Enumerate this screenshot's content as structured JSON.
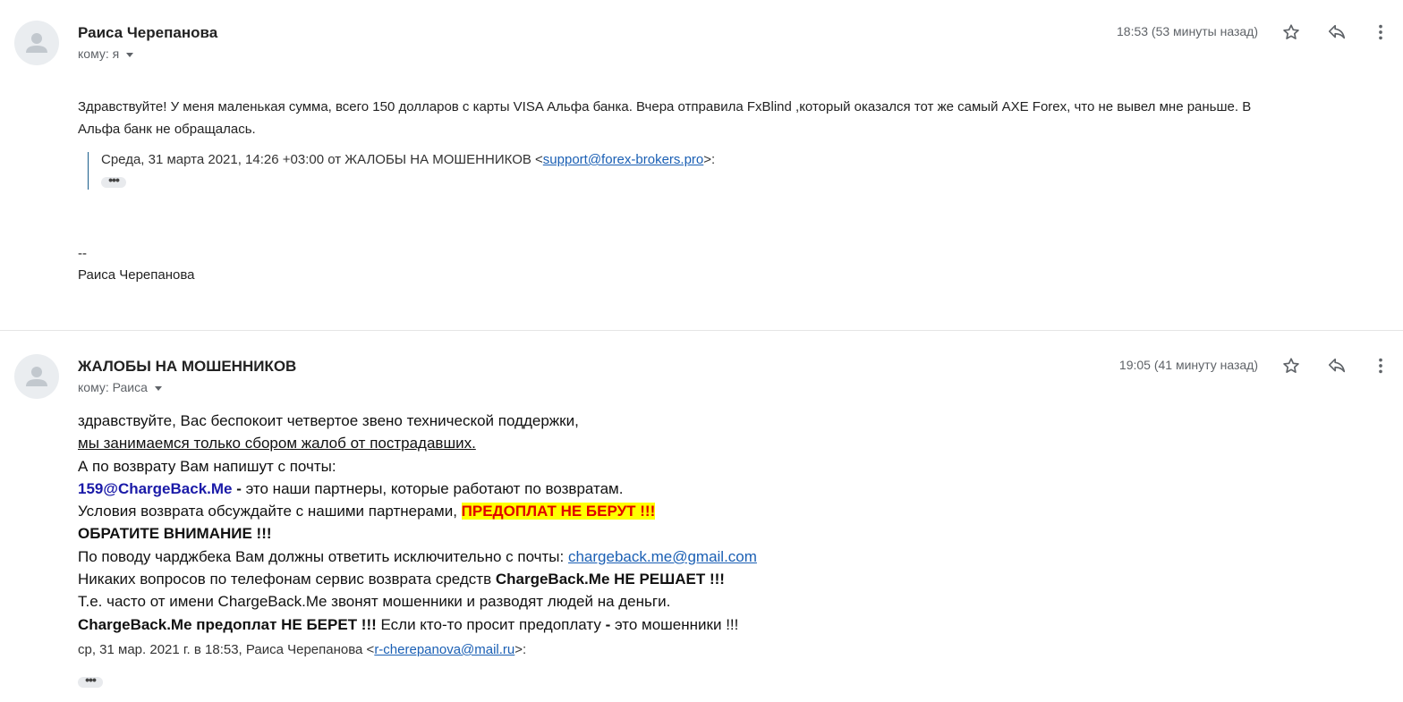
{
  "messages": [
    {
      "sender": "Раиса Черепанова",
      "to": "кому: я",
      "time": "18:53 (53 минуты назад)",
      "body_line1": "Здравствуйте! У меня маленькая сумма, всего 150 долларов с карты VISA Альфа банка. Вчера отправила FxBlind ,который оказался тот же самый AXE Forex, что не вывел мне раньше. В",
      "body_line2": "Альфа банк не обращалась.",
      "quote_prefix": "Среда, 31 марта 2021, 14:26 +03:00 от ЖАЛОБЫ НА МОШЕННИКОВ <",
      "quote_email": "support@forex-brokers.pro",
      "quote_suffix": ">:",
      "ellipsis": "•••",
      "sig_dash": "--",
      "sig_name": "Раиса Черепанова"
    },
    {
      "sender": "ЖАЛОБЫ НА МОШЕННИКОВ",
      "to": "кому: Раиса",
      "time": "19:05 (41 минуту назад)",
      "l1": "здравствуйте, Вас беспокоит четвертое звено технической поддержки,",
      "l2": "мы занимаемся только сбором жалоб от пострадавших.",
      "l3": "А по возврату Вам напишут с почты:",
      "l4_email": "159@ChargeBack.Me",
      "l4_dash": " - ",
      "l4_rest": "это наши партнеры, которые работают по возвратам.",
      "l5_text": "Условия возврата обсуждайте с нашими партнерами, ",
      "l5_hl": "ПРЕДОПЛАТ НЕ БЕРУТ !!!",
      "l6": "ОБРАТИТЕ ВНИМАНИЕ !!!",
      "l7_text": "По поводу чарджбека Вам должны ответить исключительно с почты: ",
      "l7_email": "chargeback.me@gmail.com",
      "l8_text": "Никаких вопросов по телефонам сервис возврата средств ",
      "l8_bold": "ChargeBack.Me НЕ РЕШАЕТ !!!",
      "l9": "Т.е. часто от имени ChargeBack.Me звонят мошенники и разводят людей на деньги.",
      "l10_bold": "ChargeBack.Me предоплат НЕ БЕРЕТ !!!",
      "l10_text": " Если кто-то просит предоплату ",
      "l10_dash": "-",
      "l10_rest": " это мошенники !!!",
      "reply_prefix": "ср, 31 мар. 2021 г. в 18:53, Раиса Черепанова <",
      "reply_email": "r-cherepanova@mail.ru",
      "reply_suffix": ">:",
      "ellipsis": "•••"
    }
  ],
  "icons": [
    "avatar-icon",
    "star-icon",
    "reply-icon",
    "more-vert-icon",
    "chevron-down-icon"
  ]
}
